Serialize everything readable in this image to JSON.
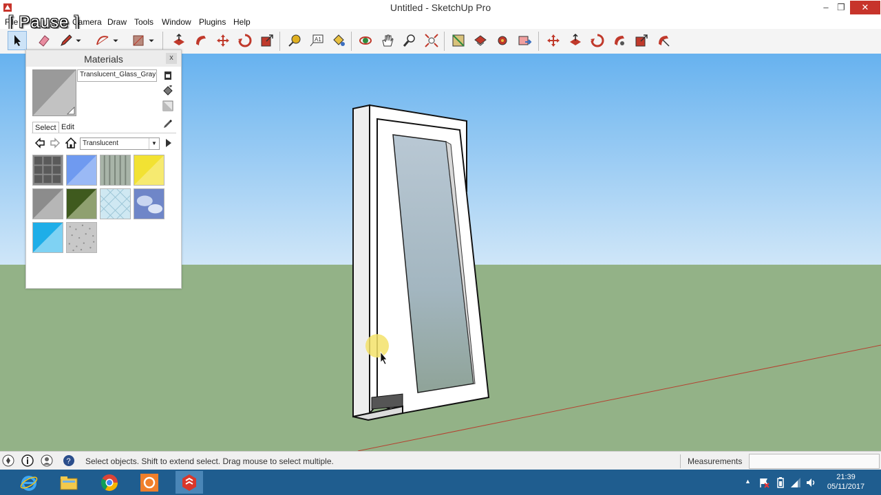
{
  "window": {
    "title": "Untitled - SketchUp Pro",
    "min_label": "–",
    "max_label": "❐",
    "close_label": "✕"
  },
  "menu": {
    "items": [
      "File",
      "Camera",
      "Draw",
      "Tools",
      "Window",
      "Plugins",
      "Help"
    ]
  },
  "overlay": {
    "pause_label": "[ Pause ]"
  },
  "toolbar": {
    "tools": [
      "select-tool",
      "eraser-tool",
      "pencil-tool",
      "arc-tool",
      "rectangle-tool",
      "push-pull-tool",
      "follow-me-tool",
      "move-tool",
      "rotate-tool",
      "scale-tool",
      "tape-measure-tool",
      "text-tool",
      "paint-bucket-tool",
      "orbit-tool",
      "pan-tool",
      "zoom-tool",
      "zoom-extents-tool",
      "get-models-tool",
      "share-model-tool",
      "extension-warehouse-tool",
      "send-to-layout-tool",
      "solid-move-tool",
      "push-pull-ext-tool",
      "rotate-ext-tool",
      "follow-me-ext-tool",
      "scale-ext-tool",
      "offset-tool"
    ]
  },
  "materials": {
    "title": "Materials",
    "close_label": "x",
    "current_name": "Translucent_Glass_Gray",
    "tab_select": "Select",
    "tab_edit": "Edit",
    "collection": "Translucent",
    "combo_arrow": "▼",
    "swatches": [
      "translucent-glass-block",
      "translucent-glass-blue",
      "translucent-glass-corrugated",
      "translucent-glass-yellow",
      "translucent-glass-gray",
      "translucent-glass-green",
      "translucent-glass-safety",
      "translucent-glass-sky",
      "translucent-glass-cyan",
      "translucent-glass-frosted"
    ]
  },
  "status": {
    "message": "Select objects. Shift to extend select. Drag mouse to select multiple.",
    "measurements_label": "Measurements",
    "measurements_value": ""
  },
  "taskbar": {
    "apps": [
      "internet-explorer",
      "file-explorer",
      "chrome",
      "media-app",
      "sketchup"
    ],
    "tray_arrow": "▲",
    "time": "21:39",
    "date": "05/11/2017"
  },
  "colors": {
    "sky_top": "#67b2ef",
    "sky_bottom": "#cfe6f8",
    "ground": "#93b287",
    "accent_red": "#c7342b",
    "taskbar": "#1f5d8f"
  }
}
